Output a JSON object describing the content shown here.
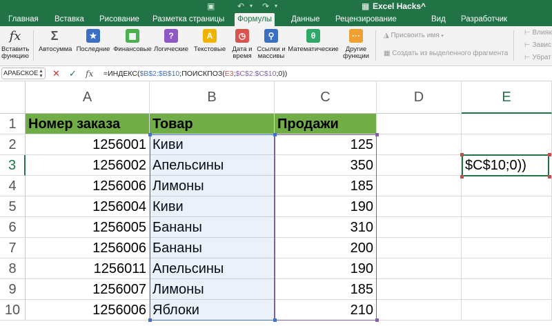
{
  "title_bar": {
    "app_title": "Excel Hacks^"
  },
  "tabs": [
    "Главная",
    "Вставка",
    "Рисование",
    "Разметка страницы",
    "Формулы",
    "Данные",
    "Рецензирование",
    "Вид",
    "Разработчик"
  ],
  "active_tab": "Формулы",
  "ribbon": {
    "insert_function": {
      "line1": "Вставить",
      "line2": "функцию"
    },
    "buttons": [
      {
        "line1": "Автосумма",
        "line2": ""
      },
      {
        "line1": "Последние",
        "line2": ""
      },
      {
        "line1": "Финансовые",
        "line2": ""
      },
      {
        "line1": "Логические",
        "line2": ""
      },
      {
        "line1": "Текстовые",
        "line2": ""
      },
      {
        "line1": "Дата и",
        "line2": "время"
      },
      {
        "line1": "Ссылки и",
        "line2": "массивы"
      },
      {
        "line1": "Математические",
        "line2": ""
      },
      {
        "line1": "Другие",
        "line2": "функции"
      }
    ],
    "assign_name": "Присвоить имя",
    "create_from_selection": "Создать из выделенного фрагмента",
    "right_truncated": [
      "Влияю",
      "Завис",
      "Убрат"
    ]
  },
  "formula_bar": {
    "name_box": "АРАБСКОЕ",
    "fx_label": "fx",
    "formula_parts": [
      {
        "text": "=ИНДЕКС(",
        "ref": ""
      },
      {
        "text": "$B$2:$B$10",
        "ref": "blue"
      },
      {
        "text": ";ПОИСКПОЗ(",
        "ref": ""
      },
      {
        "text": "E3",
        "ref": "red"
      },
      {
        "text": ";",
        "ref": ""
      },
      {
        "text": "$C$2:$C$10",
        "ref": "purple"
      },
      {
        "text": ";0))",
        "ref": ""
      }
    ]
  },
  "columns": [
    "A",
    "B",
    "C",
    "D",
    "E"
  ],
  "row_numbers": [
    "1",
    "2",
    "3",
    "4",
    "5",
    "6",
    "7",
    "8",
    "9",
    "10"
  ],
  "headers": {
    "a": "Номер заказа",
    "b": "Товар",
    "c": "Продажи"
  },
  "rows": [
    {
      "a": "1256001",
      "b": "Киви",
      "c": "125"
    },
    {
      "a": "1256002",
      "b": "Апельсины",
      "c": "350"
    },
    {
      "a": "1256006",
      "b": "Лимоны",
      "c": "185"
    },
    {
      "a": "1256004",
      "b": "Киви",
      "c": "190"
    },
    {
      "a": "1256005",
      "b": "Бананы",
      "c": "310"
    },
    {
      "a": "1256006",
      "b": "Бананы",
      "c": "200"
    },
    {
      "a": "1256011",
      "b": "Апельсины",
      "c": "190"
    },
    {
      "a": "1256007",
      "b": "Лимоны",
      "c": "185"
    },
    {
      "a": "1256006",
      "b": "Яблоки",
      "c": "210"
    }
  ],
  "edit_cell": {
    "value": "$C$10;0))"
  },
  "colors": {
    "ribbon_green": "#217346",
    "header_fill": "#70ad47",
    "ref_blue": "#4472c4",
    "ref_red": "#c0504d",
    "ref_purple": "#8064a2"
  }
}
